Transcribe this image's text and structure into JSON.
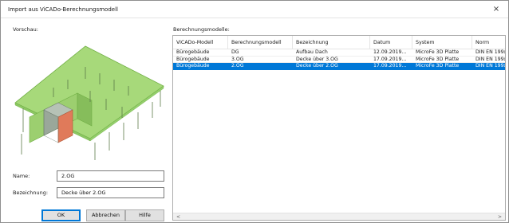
{
  "window": {
    "title": "Import aus ViCADo-Berechnungsmodell",
    "close_glyph": "×"
  },
  "preview": {
    "label": "Vorschau:",
    "colors": {
      "slab": "#a7d97a",
      "slab_edge": "#6fae43",
      "box_gray": "#9aa79a",
      "box_red": "#e07a5a",
      "columns": "#5c7a4a"
    }
  },
  "form": {
    "name_label": "Name:",
    "name_value": "2.OG",
    "bezeichnung_label": "Bezeichnung:",
    "bezeichnung_value": "Decke über 2.OG"
  },
  "buttons": {
    "ok": "OK",
    "cancel": "Abbrechen",
    "help": "Hilfe"
  },
  "models": {
    "label": "Berechnungsmodelle:",
    "columns": [
      "ViCADo-Modell",
      "Berechnungsmodell",
      "Bezeichnung",
      "Datum",
      "System",
      "Norm"
    ],
    "rows": [
      [
        "Bürogebäude",
        "DG",
        "Aufbau Dach",
        "12.09.2019...",
        "MicroFe 3D Platte",
        "DIN EN 199x"
      ],
      [
        "Bürogebäude",
        "3.OG",
        "Decke über 3.OG",
        "17.09.2019...",
        "MicroFe 3D Platte",
        "DIN EN 199x"
      ],
      [
        "Bürogebäude",
        "2.OG",
        "Decke über 2.OG",
        "17.09.2019...",
        "MicroFe 3D Platte",
        "DIN EN 199x"
      ]
    ],
    "selected_index": 2,
    "scroll_left": "<",
    "scroll_right": ">",
    "colors": {
      "selection": "#0078d7"
    }
  }
}
